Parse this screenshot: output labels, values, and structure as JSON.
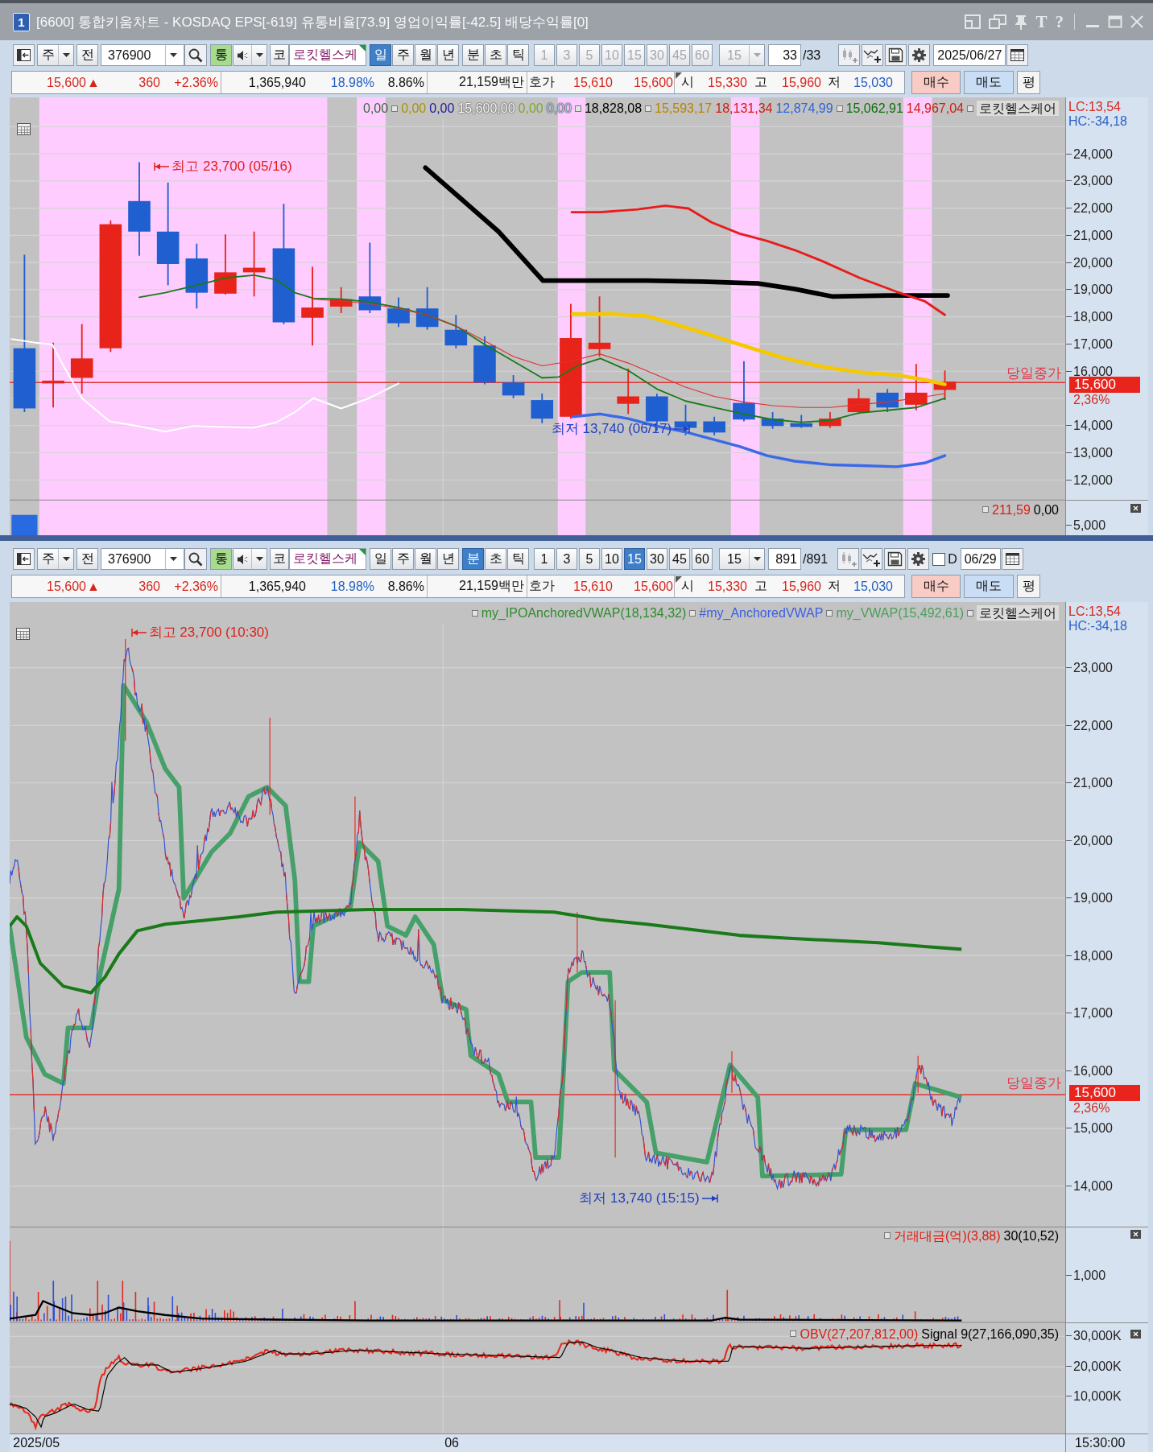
{
  "window": {
    "badge": "1",
    "title": "[6600] 통합키움차트 - KOSDAQ EPS[-619] 유통비율[73.9] 영업이익률[-42.5] 배당수익률[0]",
    "tool_glyphs": [
      "T",
      "?"
    ]
  },
  "panes": [
    {
      "toolbar": {
        "chart_type": "주",
        "prev": "전",
        "code": "376900",
        "sound_toggle": "통",
        "market": "코",
        "stock_name": "로킷헬스케",
        "periods": [
          {
            "label": "일",
            "selected": true
          },
          {
            "label": "주",
            "selected": false
          },
          {
            "label": "월",
            "selected": false
          },
          {
            "label": "년",
            "selected": false
          }
        ],
        "units": [
          {
            "label": "분",
            "selected": false
          },
          {
            "label": "초",
            "selected": false
          },
          {
            "label": "틱",
            "selected": false
          }
        ],
        "intervals": [
          {
            "label": "1",
            "selected": false,
            "disabled": true
          },
          {
            "label": "3",
            "selected": false,
            "disabled": true
          },
          {
            "label": "5",
            "selected": false,
            "disabled": true
          },
          {
            "label": "10",
            "selected": false,
            "disabled": true
          },
          {
            "label": "15",
            "selected": false,
            "disabled": true
          },
          {
            "label": "30",
            "selected": false,
            "disabled": true
          },
          {
            "label": "45",
            "selected": false,
            "disabled": true
          },
          {
            "label": "60",
            "selected": false,
            "disabled": true
          }
        ],
        "interval_combo": {
          "value": "15",
          "disabled": true
        },
        "count": "33",
        "total": "/33",
        "date": "2025/06/27"
      },
      "quote": {
        "price": "15,600",
        "direction": "▲",
        "change": "360",
        "change_rate": "+2.36%",
        "volume": "1,365,940",
        "turnover": "18.98%",
        "ratio": "8.86%",
        "amount": "21,159백만",
        "ask_label": "호가",
        "ask": "15,610",
        "bid": "15,600",
        "open_label": "시",
        "open": "15,330",
        "high_label": "고",
        "high": "15,960",
        "low_label": "저",
        "low": "15,030",
        "actions": [
          {
            "label": "매수",
            "kind": "buy"
          },
          {
            "label": "매도",
            "kind": "sell"
          },
          {
            "label": "평",
            "kind": "plain"
          }
        ]
      },
      "chart": {
        "kind": "daily",
        "legend": [
          {
            "text": "0,00",
            "color": "#3a6a3a",
            "marker": false
          },
          {
            "text": "0,00",
            "color": "#a89400",
            "marker": true
          },
          {
            "text": "0,00",
            "color": "#1a1a9a",
            "marker": false
          },
          {
            "text": "15,600,00",
            "color": "#ffffff",
            "marker": false
          },
          {
            "text": "0,00",
            "color": "#7fa82a",
            "marker": false
          },
          {
            "text": "0,00",
            "color": "#a9c6e4",
            "marker": false
          },
          {
            "text": "18,828,08",
            "color": "#000000",
            "marker": true
          },
          {
            "text": "15,593,17",
            "color": "#b88400",
            "marker": true
          },
          {
            "text": "18,131,34",
            "color": "#d01c14",
            "marker": false
          },
          {
            "text": "12,874,99",
            "color": "#2a64dc",
            "marker": false
          },
          {
            "text": "15,062,91",
            "color": "#0e6e0e",
            "marker": true
          },
          {
            "text": "14,967,04",
            "color": "#d01c14",
            "marker": false
          }
        ],
        "symbol": "로킷헬스케어",
        "lc": "LC:13,54",
        "hc": "HC:-34,18",
        "high_note": "최고 23,700 (05/16)",
        "low_note": "최저 13,740 (06/17)",
        "close_label": "당일종가",
        "close_price": "15,600",
        "close_rate": "2,36%",
        "y_ticks": [
          "24,000",
          "23,000",
          "22,000",
          "21,000",
          "20,000",
          "19,000",
          "18,000",
          "17,000",
          "16,000",
          "14,000",
          "13,000",
          "12,000"
        ],
        "sub_legend": [
          {
            "text": "211,59",
            "color": "#e01a10",
            "marker": true
          },
          {
            "text": "0,00",
            "color": "#000000",
            "marker": false
          }
        ],
        "sub_ticks": [
          "5,000"
        ]
      }
    },
    {
      "toolbar": {
        "chart_type": "주",
        "prev": "전",
        "code": "376900",
        "sound_toggle": "통",
        "market": "코",
        "stock_name": "로킷헬스케",
        "periods": [
          {
            "label": "일",
            "selected": false
          },
          {
            "label": "주",
            "selected": false
          },
          {
            "label": "월",
            "selected": false
          },
          {
            "label": "년",
            "selected": false
          }
        ],
        "units": [
          {
            "label": "분",
            "selected": true
          },
          {
            "label": "초",
            "selected": false
          },
          {
            "label": "틱",
            "selected": false
          }
        ],
        "intervals": [
          {
            "label": "1",
            "selected": false,
            "disabled": false
          },
          {
            "label": "3",
            "selected": false,
            "disabled": false
          },
          {
            "label": "5",
            "selected": false,
            "disabled": false
          },
          {
            "label": "10",
            "selected": false,
            "disabled": false
          },
          {
            "label": "15",
            "selected": true,
            "disabled": false
          },
          {
            "label": "30",
            "selected": false,
            "disabled": false
          },
          {
            "label": "45",
            "selected": false,
            "disabled": false
          },
          {
            "label": "60",
            "selected": false,
            "disabled": false
          }
        ],
        "interval_combo": {
          "value": "15",
          "disabled": false
        },
        "count": "891",
        "total": "/891",
        "day_checkbox": {
          "label": "D",
          "checked": false
        },
        "date": "06/29"
      },
      "quote": {
        "price": "15,600",
        "direction": "▲",
        "change": "360",
        "change_rate": "+2.36%",
        "volume": "1,365,940",
        "turnover": "18.98%",
        "ratio": "8.86%",
        "amount": "21,159백만",
        "ask_label": "호가",
        "ask": "15,610",
        "bid": "15,600",
        "open_label": "시",
        "open": "15,330",
        "high_label": "고",
        "high": "15,960",
        "low_label": "저",
        "low": "15,030",
        "actions": [
          {
            "label": "매수",
            "kind": "buy"
          },
          {
            "label": "매도",
            "kind": "sell"
          },
          {
            "label": "평",
            "kind": "plain"
          }
        ]
      },
      "chart": {
        "kind": "intraday",
        "legend": [
          {
            "text": "my_IPOAnchoredVWAP(18,134,32)",
            "color": "#2e8b2e",
            "marker": true
          },
          {
            "text": "#my_AnchoredVWAP",
            "color": "#3b5fe0",
            "marker": true
          },
          {
            "text": "my_VWAP(15,492,61)",
            "color": "#4a9e5a",
            "marker": true
          }
        ],
        "symbol": "로킷헬스케어",
        "lc": "LC:13,54",
        "hc": "HC:-34,18",
        "high_note": "최고 23,700 (10:30)",
        "low_note": "최저 13,740 (15:15)",
        "close_label": "당일종가",
        "close_price": "15,600",
        "close_rate": "2,36%",
        "y_ticks": [
          "23,000",
          "22,000",
          "21,000",
          "20,000",
          "19,000",
          "18,000",
          "17,000",
          "16,000",
          "15,000",
          "14,000"
        ],
        "volume_panel": {
          "legend": [
            {
              "text": "거래대금(억)(3,88)",
              "color": "#e01a10",
              "marker": true
            },
            {
              "text": "30(10,52)",
              "color": "#000000",
              "marker": false
            }
          ],
          "ticks": [
            "1,000"
          ]
        },
        "obv_panel": {
          "legend": [
            {
              "text": "OBV(27,207,812,00)",
              "color": "#e01a10",
              "marker": true
            },
            {
              "text": "Signal 9(27,166,090,35)",
              "color": "#000000",
              "marker": false
            }
          ],
          "ticks": [
            "30,000K",
            "20,000K",
            "10,000K"
          ]
        },
        "x_labels": [
          "2025/05",
          "06"
        ],
        "time_label": "15:30:00"
      }
    }
  ]
}
